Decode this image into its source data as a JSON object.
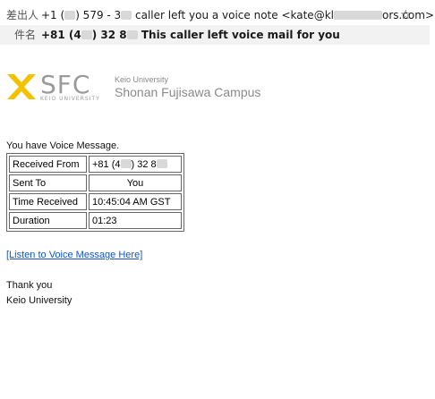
{
  "email_header": {
    "from_label": "差出人",
    "from_value_prefix": "+1 (",
    "from_value_mid1": ") 579 - 3",
    "from_value_mid2": " caller left you a voice note <kate@kl",
    "from_value_suffix": "ors.com>",
    "subject_label": "件名",
    "subject_prefix": "+81 (4",
    "subject_mid": ") 32 8",
    "subject_suffix": " This caller left voice mail for you",
    "star_icon": "star-outline-icon"
  },
  "logo": {
    "mark_color": "#f2c200",
    "sfc_text": "SFC",
    "sub_text": "KEIO UNIVERSITY",
    "university_text": "Keio University",
    "campus_text": "Shonan Fujisawa Campus"
  },
  "message": {
    "intro": "You have Voice Message.",
    "table": [
      {
        "label": "Received From",
        "value_prefix": "+81 (4",
        "value_mid": ") 32 8",
        "value_suffix": ""
      },
      {
        "label": "Sent To",
        "value": "You"
      },
      {
        "label": "Time Received",
        "value": "10:45:04 AM GST"
      },
      {
        "label": "Duration",
        "value": "01:23"
      }
    ],
    "link_text": "[Listen to Voice Message Here]",
    "link_color": "#1155cc",
    "thanks": "Thank you",
    "signature": "Keio University"
  }
}
